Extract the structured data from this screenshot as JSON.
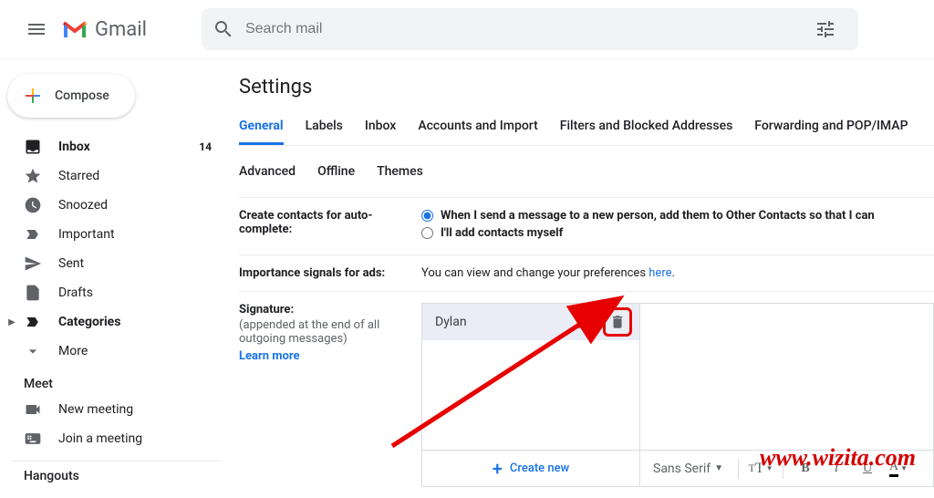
{
  "header": {
    "brand": "Gmail",
    "search_placeholder": "Search mail"
  },
  "sidebar": {
    "compose": "Compose",
    "items": [
      {
        "label": "Inbox",
        "count": "14",
        "bold": true
      },
      {
        "label": "Starred"
      },
      {
        "label": "Snoozed"
      },
      {
        "label": "Important"
      },
      {
        "label": "Sent"
      },
      {
        "label": "Drafts"
      },
      {
        "label": "Categories",
        "bold": true,
        "caret": true
      },
      {
        "label": "More"
      }
    ],
    "meet_label": "Meet",
    "meet_items": [
      {
        "label": "New meeting"
      },
      {
        "label": "Join a meeting"
      }
    ],
    "hangouts_label": "Hangouts"
  },
  "main": {
    "title": "Settings",
    "tabs": [
      "General",
      "Labels",
      "Inbox",
      "Accounts and Import",
      "Filters and Blocked Addresses",
      "Forwarding and POP/IMAP"
    ],
    "tabs2": [
      "Advanced",
      "Offline",
      "Themes"
    ],
    "active_tab": 0,
    "contacts": {
      "label": "Create contacts for auto-complete:",
      "opt1": "When I send a message to a new person, add them to Other Contacts so that I can",
      "opt2": "I'll add contacts myself"
    },
    "importance": {
      "label": "Importance signals for ads:",
      "text_pre": "You can view and change your preferences ",
      "link": "here",
      "text_post": "."
    },
    "signature": {
      "label": "Signature:",
      "desc": "(appended at the end of all outgoing messages)",
      "learn": "Learn more",
      "selected": "Dylan",
      "font": "Sans Serif",
      "create_new": "Create new"
    }
  },
  "toolbar": {
    "size": "tT",
    "bold": "B",
    "italic": "I",
    "underline": "U",
    "color": "A"
  },
  "watermark": "www.wizita.com"
}
